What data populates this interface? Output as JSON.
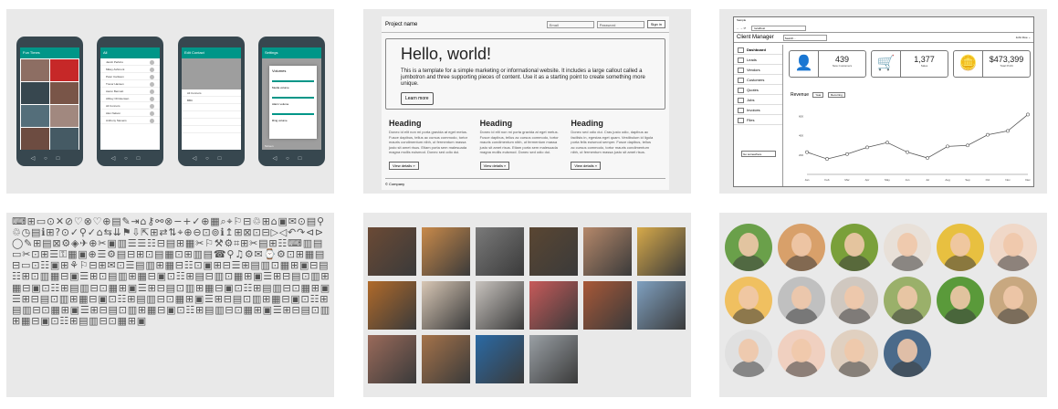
{
  "mobile": {
    "phones": [
      {
        "title": "Fun Times",
        "kind": "gallery",
        "tiles": [
          "#8d6e63",
          "#c62828",
          "#37474f",
          "#795548",
          "#546e7a",
          "#a1887f",
          "#6d4c41",
          "#455a64"
        ]
      },
      {
        "title": "All",
        "kind": "contacts",
        "rows": [
          "Jacob Perkins",
          "Mikey Ashmont",
          "Peter Carlsson",
          "Trevor Hansen",
          "Aaron Bennett",
          "Abbey Christensen",
          "Ali Connors",
          "Alex Nelson",
          "Anthony Stevens"
        ]
      },
      {
        "title": "Edit Contact",
        "kind": "form",
        "rows": [
          "Ali Connors",
          "BBC",
          "",
          "",
          "",
          ""
        ]
      },
      {
        "title": "Settings",
        "kind": "dialog",
        "dialog_title": "Volumes",
        "labels": [
          "Media volume",
          "Alarm volume",
          "Ring volume"
        ],
        "footer": "Screen"
      }
    ]
  },
  "bootstrap": {
    "brand": "Project name",
    "email_placeholder": "Email",
    "password_placeholder": "Password",
    "signin": "Sign in",
    "heading": "Hello, world!",
    "lead": "This is a template for a simple marketing or informational website. It includes a large callout called a jumbotron and three supporting pieces of content. Use it as a starting point to create something more unique.",
    "learn_more": "Learn more",
    "columns": [
      {
        "title": "Heading",
        "body": "Donec id elit non mi porta gravida at eget metus. Fusce dapibus, tellus ac cursus commodo, tortor mauris condimentum nibh, ut fermentum massa justo sit amet risus. Etiam porta sem malesuada magna mollis euismod. Donec sed odio dui.",
        "button": "View details »"
      },
      {
        "title": "Heading",
        "body": "Donec id elit non mi porta gravida at eget metus. Fusce dapibus, tellus ac cursus commodo, tortor mauris condimentum nibh, ut fermentum massa justo sit amet risus. Etiam porta sem malesuada magna mollis euismod. Donec sed odio dui.",
        "button": "View details »"
      },
      {
        "title": "Heading",
        "body": "Donec sed odio dui. Cras justo odio, dapibus ac facilisis in, egestas eget quam. Vestibulum id ligula porta felis euismod semper. Fusce dapibus, tellus ac cursus commodo, tortor mauris condimentum nibh, ut fermentum massa justo sit amet risus.",
        "button": "View details »"
      }
    ],
    "footer": "© Company"
  },
  "client_manager": {
    "window_title": "Sample",
    "url": "localhost",
    "app_title": "Client Manager",
    "search_placeholder": "Search...",
    "user": "John Doe ⌄",
    "nav": [
      "Dashboard",
      "Leads",
      "Vendors",
      "Customers",
      "Quotes",
      "Jobs",
      "Invoices",
      "Files"
    ],
    "side_button": "Go somewhere",
    "cards": [
      {
        "icon": "user-icon",
        "glyph": "👤",
        "value": "439",
        "label": "New Customers"
      },
      {
        "icon": "cart-icon",
        "glyph": "🛒",
        "value": "1,377",
        "label": "Sales"
      },
      {
        "icon": "coins-icon",
        "glyph": "🪙",
        "value": "$473,399",
        "label": "Total Profit"
      }
    ],
    "revenue_label": "Revenue",
    "revenue_filter1": "Year",
    "revenue_filter2": "Recurring"
  },
  "chart_data": {
    "type": "line",
    "categories": [
      "Jan",
      "Feb",
      "Mar",
      "Apr",
      "May",
      "Jun",
      "Jul",
      "Aug",
      "Sep",
      "Oct",
      "Nov",
      "Dec"
    ],
    "values": [
      230,
      160,
      210,
      280,
      330,
      230,
      170,
      290,
      300,
      410,
      450,
      620
    ],
    "ylim": [
      0,
      700
    ],
    "yticks": [
      200,
      400,
      600
    ],
    "title": "",
    "xlabel": "",
    "ylabel": ""
  },
  "icon_glyphs": "⌨⊞▭⊙✕⊘♡⊗♡⊕▤✎⇥⌂⚷⚯⊗−+✓⊕▦⌕⌖⚐⊟♲⊞⌂▣✉⊙▤⚲♲◷▤ℹ⊞?⊙✓⚲✓⌂⇆⇊⚑⇩⇱⊞⇄⇅⌖⊕⊖⊡⊚ℹ↥⊞⊠⊡⊟▷◁↶↷⊲⊳◯✎⊞▤⊠⚙◈✈⊕✂▣▥☰☰☷⊟▤⊞▦✂⚐⚒⚙⌗⊞✂▤⊞☷⌨▥▤▭✂⊡⊞☰⚿▦▣⊕☰⚙▤⊟⊞⊡▤▦⊡⊞▥▤☎⚲♫⚙✉⌚⚙⊡⊞▦▤⊟▭⊡☷▣⊞⚘⚐⊟⊞✉⊡☰▤▥⊞▦⊟☷⊡▣⊞⊟☰⊞▤▥⊡▦⊞▣⊟▤☷⊞⊡▥▦⊟▣☰⊞⊡▤▥⊞▦⊟▣⊡☷⊞▤⊟▥⊡▦⊞▣☰⊞⊟▤⊡▥⊞▦⊟▣⊡☷⊞▤▥⊟⊡▦⊞▣☰⊞⊟▤⊡▥⊞▦⊟▣⊡☷⊞▤▥⊟⊡▦⊞▣☰⊞⊟▤⊡▥⊞▦⊟▣⊡☷⊞▤▥⊟⊡▦⊞▣☰⊞⊟▤⊡▥⊞▦⊟▣⊡☷⊞▤▥⊟⊡▦⊞▣☰⊞⊟▤⊡▥⊞▦⊟▣⊡☷⊞▤▥⊟⊡▦⊞▣☰⊞⊟▤⊡▥⊞▦⊟▣⊡☷⊞▤▥⊟⊡▦⊞▣",
  "photos": [
    "#6b4a35",
    "#c98a4a",
    "#7a7a7a",
    "#5a4632",
    "#b5886a",
    "#d6a94a",
    "#b06a2a",
    "#d8c7b5",
    "#c8c3be",
    "#c75a5a",
    "#a85838",
    "#7fa0c0",
    "#9a6a5a",
    "#a5734a",
    "#2a6aa5",
    "#9aa0a5"
  ],
  "avatars": [
    "#6aa04a",
    "#d8a06a",
    "#7aa03a",
    "#e8e0d8",
    "#e8c040",
    "#f0d8c8",
    "#f0c060",
    "#c0c0c0",
    "#d0c8c0",
    "#9ab06a",
    "#5a9a3a",
    "#c8a880",
    "#e0e0e0",
    "#f0d0c0",
    "#e0d0c0",
    "#4a6a8a"
  ]
}
